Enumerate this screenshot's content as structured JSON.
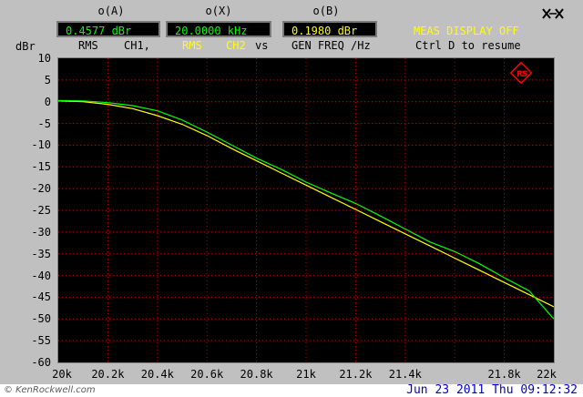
{
  "colors": {
    "trace_a": "#ffff00",
    "trace_b": "#00ff00",
    "grid": "#c00000",
    "plot_bg": "#000000",
    "marker": "#ff0000"
  },
  "readouts": {
    "a": {
      "label": "o(A)",
      "value": "0.4577 dBr",
      "color": "#00ff00"
    },
    "x": {
      "label": "o(X)",
      "value": "20.0000 kHz",
      "color": "#00ff00"
    },
    "b": {
      "label": "o(B)",
      "value": "0.1980 dBr",
      "color": "#ffff00"
    }
  },
  "sublabels": {
    "rms": "RMS",
    "ch1": "CH1,",
    "rms2": "RMS",
    "ch2": "CH2",
    "vs": "vs",
    "gen_freq": "GEN FREQ /Hz"
  },
  "status": {
    "meas_off": "MEAS DISPLAY OFF",
    "ctrl_d": "Ctrl D to resume"
  },
  "toolbar": {
    "icon": "infinity-icon"
  },
  "y_unit": "dBr",
  "footer": {
    "watermark": "© KenRockwell.com",
    "datetime": "Jun 23 2011 Thu 09:12:32"
  },
  "chart_data": {
    "type": "line",
    "ylabel": "dBr",
    "ylim": [
      -60,
      10
    ],
    "xlim": [
      20000,
      22000
    ],
    "yticks": [
      "10",
      "5",
      "0",
      "-5",
      "-10",
      "-15",
      "-20",
      "-25",
      "-30",
      "-35",
      "-40",
      "-45",
      "-50",
      "-55",
      "-60"
    ],
    "yvalues": [
      10,
      5,
      0,
      -5,
      -10,
      -15,
      -20,
      -25,
      -30,
      -35,
      -40,
      -45,
      -50,
      -55,
      -60
    ],
    "xticks": [
      {
        "label": "20k",
        "value": 20000
      },
      {
        "label": "20.2k",
        "value": 20200
      },
      {
        "label": "20.4k",
        "value": 20400
      },
      {
        "label": "20.6k",
        "value": 20600
      },
      {
        "label": "20.8k",
        "value": 20800
      },
      {
        "label": "21k",
        "value": 21000
      },
      {
        "label": "21.2k",
        "value": 21200
      },
      {
        "label": "21.4k",
        "value": 21400
      },
      {
        "label": "21.8k",
        "value": 21800
      },
      {
        "label": "22k",
        "value": 22000
      }
    ],
    "grid": true,
    "series": [
      {
        "color": "#ffff00",
        "x": [
          20000,
          20100,
          20200,
          20300,
          20400,
          20500,
          20600,
          20700,
          20800,
          20900,
          21000,
          21100,
          21200,
          21300,
          21400,
          21500,
          21600,
          21700,
          21800,
          21900,
          22000
        ],
        "y": [
          0.2,
          0,
          -0.6,
          -1.6,
          -3.2,
          -5.2,
          -7.8,
          -10.8,
          -13.6,
          -16.4,
          -19.2,
          -22,
          -24.8,
          -27.6,
          -30.4,
          -33.2,
          -36,
          -38.8,
          -41.6,
          -44.4,
          -47.2
        ]
      },
      {
        "color": "#00ff00",
        "x": [
          20000,
          20100,
          20200,
          20300,
          20400,
          20500,
          20600,
          20700,
          20800,
          20900,
          21000,
          21100,
          21200,
          21300,
          21400,
          21500,
          21600,
          21700,
          21800,
          21900,
          22000
        ],
        "y": [
          0.3,
          0.2,
          -0.2,
          -0.9,
          -2.1,
          -4.2,
          -7,
          -10,
          -13,
          -15.6,
          -18.5,
          -21,
          -23.4,
          -26.3,
          -29.3,
          -32.3,
          -34.5,
          -37.3,
          -40.5,
          -43.5,
          -50
        ]
      }
    ]
  }
}
